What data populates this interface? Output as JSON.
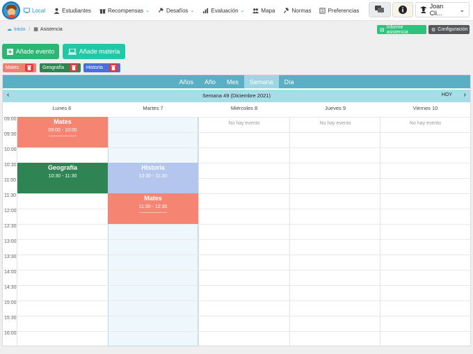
{
  "nav": {
    "items": [
      {
        "label": "Local",
        "icon": "monitor-icon",
        "active": true
      },
      {
        "label": "Estudiantes",
        "icon": "user-icon"
      },
      {
        "label": "Recompensas",
        "icon": "gift-icon",
        "dropdown": true
      },
      {
        "label": "Desafíos",
        "icon": "hammer-icon",
        "dropdown": true
      },
      {
        "label": "Evaluación",
        "icon": "chart-icon",
        "dropdown": true
      },
      {
        "label": "Mapa",
        "icon": "people-icon"
      },
      {
        "label": "Normas",
        "icon": "gavel-icon"
      },
      {
        "label": "Preferencias",
        "icon": "sliders-icon"
      }
    ],
    "user": "Joan Cli..."
  },
  "breadcrumb": {
    "home": "Inicio",
    "current": "Asistencia"
  },
  "actions": {
    "report": "Informe asistencia",
    "config": "Configuración",
    "add_event": "Añade evento",
    "add_subject": "Añade materia"
  },
  "subjects": [
    {
      "label": "Mates",
      "color": "#f07f74"
    },
    {
      "label": "Geografía",
      "color": "#2f8453"
    },
    {
      "label": "Historia",
      "color": "#4a6fd8"
    }
  ],
  "calendar": {
    "views": [
      "Años",
      "Año",
      "Mes",
      "Semana",
      "Día"
    ],
    "active_view": "Semana",
    "week_title": "Semana 49 (Diciembre 2021)",
    "today": "HOY",
    "days": [
      "Lunes 6",
      "Martes 7",
      "Miércoles 8",
      "Jueves 9",
      "Viernes 10"
    ],
    "times": [
      "09:00",
      "09:30",
      "10:00",
      "10:30",
      "11:00",
      "11:30",
      "12:00",
      "12:30",
      "13:00",
      "13:30",
      "14:00",
      "14:30",
      "15:00",
      "15:30",
      "16:00"
    ],
    "no_event": "No hay evento",
    "events": [
      {
        "name": "Mates",
        "time": "09:00 - 10:00",
        "day": "Lunes 6",
        "color": "#f58473"
      },
      {
        "name": "Geografía",
        "time": "10:30 - 11:30",
        "day": "Lunes 6",
        "color": "#2f8453"
      },
      {
        "name": "Historia",
        "time": "10:30 - 11:30",
        "day": "Martes 7",
        "color": "#b5c6ee"
      },
      {
        "name": "Mates",
        "time": "11:30 - 12:30",
        "day": "Martes 7",
        "color": "#f58473"
      }
    ]
  }
}
